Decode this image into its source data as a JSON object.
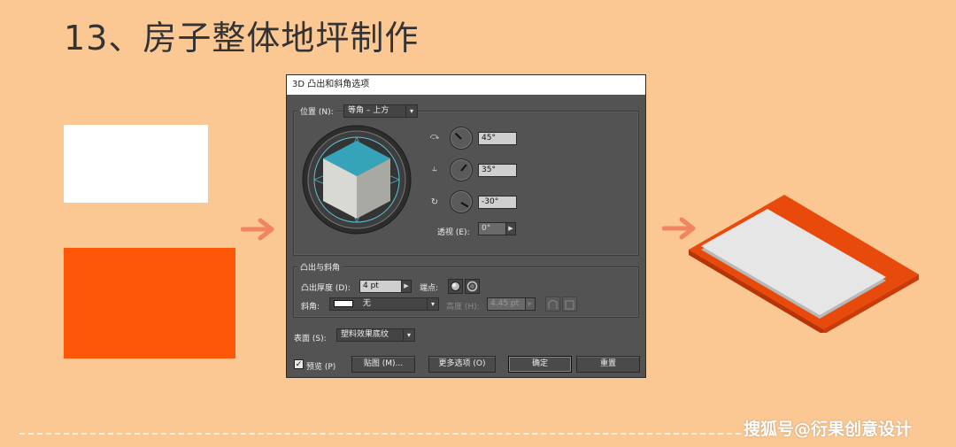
{
  "slide": {
    "title": "13、房子整体地坪制作",
    "watermark": "搜狐号@衍果创意设计"
  },
  "colors": {
    "background": "#fbc893",
    "orange": "#fd5707",
    "dark_orange": "#e0430a",
    "arrow": "#f08560",
    "cube_top": "#36a4b8"
  },
  "dialog": {
    "title": "3D 凸出和斜角选项",
    "position": {
      "legend": "位置 (N):",
      "value": "等角 – 上方",
      "x_angle": "45°",
      "y_angle": "35°",
      "z_angle": "-30°",
      "perspective_label": "透视 (E):",
      "perspective_value": "0°",
      "x_icon": "rotate-x-icon",
      "y_icon": "rotate-y-icon",
      "z_icon": "rotate-z-icon"
    },
    "extrude": {
      "legend": "凸出与斜角",
      "depth_label": "凸出厚度 (D):",
      "depth_value": "4 pt",
      "cap_label": "端点:",
      "bevel_label": "斜角:",
      "bevel_value": "无",
      "height_label": "高度 (H):",
      "height_value": "4.45 pt"
    },
    "surface": {
      "label": "表面 (S):",
      "value": "塑料效果底纹"
    },
    "footer": {
      "preview_label": "预览 (P)",
      "preview_checked": "✓",
      "map_button": "贴图 (M)...",
      "more_button": "更多选项 (O)",
      "ok_button": "确定",
      "reset_button": "重置"
    }
  }
}
